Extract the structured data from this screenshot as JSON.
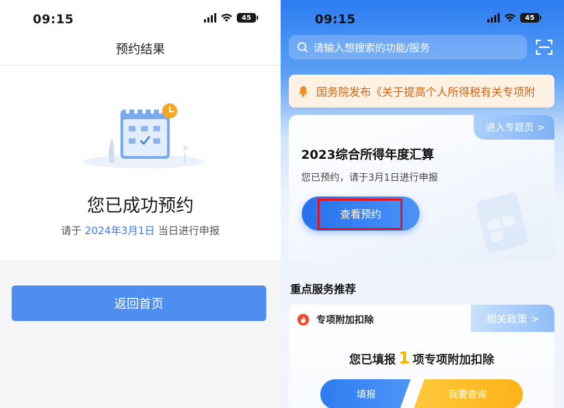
{
  "left": {
    "status": {
      "time": "09:15",
      "battery": "45"
    },
    "nav_title": "预约结果",
    "success_title": "您已成功预约",
    "success_sub": {
      "prefix": "请于",
      "date": "2024年3月1日",
      "suffix": "当日进行申报"
    },
    "home_button": "返回首页",
    "colors": {
      "primary": "#4d8ef0",
      "date": "#3a7bea"
    }
  },
  "right": {
    "status": {
      "time": "09:15",
      "battery": "45"
    },
    "search_placeholder": "请输入想搜索的功能/服务",
    "notice_text": "国务院发布《关于提高个人所得税有关专项附",
    "card": {
      "topic_link": "进入专题页 >",
      "title": "2023综合所得年度汇算",
      "subtitle": "您已预约，请于3月1日进行申报",
      "view_button": "查看预约"
    },
    "section_title": "重点服务推荐",
    "service": {
      "label": "专项附加扣除",
      "policy_link": "相关政策 >",
      "filled_prefix": "您已填报",
      "filled_count": "1",
      "filled_suffix": "项专项附加扣除",
      "fill_button": "填报",
      "query_button": "我要查询"
    },
    "colors": {
      "brand": "#2d7cf2",
      "notice": "#d06412",
      "highlight": "#e8141c",
      "count": "#f5b400"
    }
  }
}
